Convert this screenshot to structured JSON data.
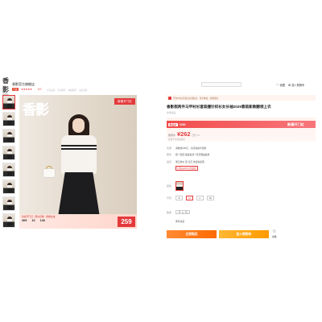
{
  "header": {
    "logo_text": "香影",
    "logo_sub": "XIANG YING",
    "store_name": "香影官方旗舰店",
    "store_badge": "天猫",
    "stars": "★★★★★",
    "store_score": "5.0",
    "nav_links": [
      "宝贝描述",
      "卖家服务",
      "物流服务",
      "进店逛逛"
    ],
    "buttons": [
      {
        "icon": "heart-icon",
        "label": "收藏"
      },
      {
        "icon": "cart-icon",
        "label": "进入购物车"
      }
    ]
  },
  "gallery": {
    "thumb_count": 8,
    "brand_overlay": "香影",
    "new_tag": "新春开门红",
    "promo_line": "新春开门红 · 限时直降 · 叠券立减",
    "promo_numbers": [
      "409",
      "10",
      "140"
    ],
    "promo_price": "259"
  },
  "product": {
    "notice": "开启VIP后享会员价及积分、专享特权、优惠更多",
    "title": "香影假两件马甲衬衫套装撞针织衫女长袖2025春装新款翻领上衣",
    "subtitle": "春季新品",
    "price_tag": "新品价",
    "price_tag_value": "¥282",
    "price_banner": "新春开门红",
    "price_label": "到手价",
    "price": "¥262",
    "price_meta": "已售 37",
    "price_note": "优惠不可叠加使用"
  },
  "rows": {
    "promo_label": "优惠",
    "promo_text": "满券送200元，全店满减享优惠",
    "service_label": "服务",
    "service_text": "假一赔四 极速退款 7天无理由退换",
    "ship_label": "发货",
    "ship_text": "浙江杭州 至 北京 快递免运费",
    "ship_note": "付款后48小时内发货",
    "color_label": "颜色",
    "size_label": "尺码",
    "sizes": [
      "S",
      "M",
      "L",
      "XL"
    ],
    "selected_size": "M",
    "qty_label": "数量",
    "qty": "1",
    "qty_minus": "−",
    "qty_plus": "+",
    "stock_text": "库存充足"
  },
  "actions": {
    "buy_now": "立即购买",
    "add_cart": "加入购物车",
    "fav_icon": "star-icon",
    "fav_label": "收藏"
  },
  "colors": {
    "accent": "#e4393c",
    "buy": "#ff6a00",
    "cart": "#ff9a00"
  }
}
